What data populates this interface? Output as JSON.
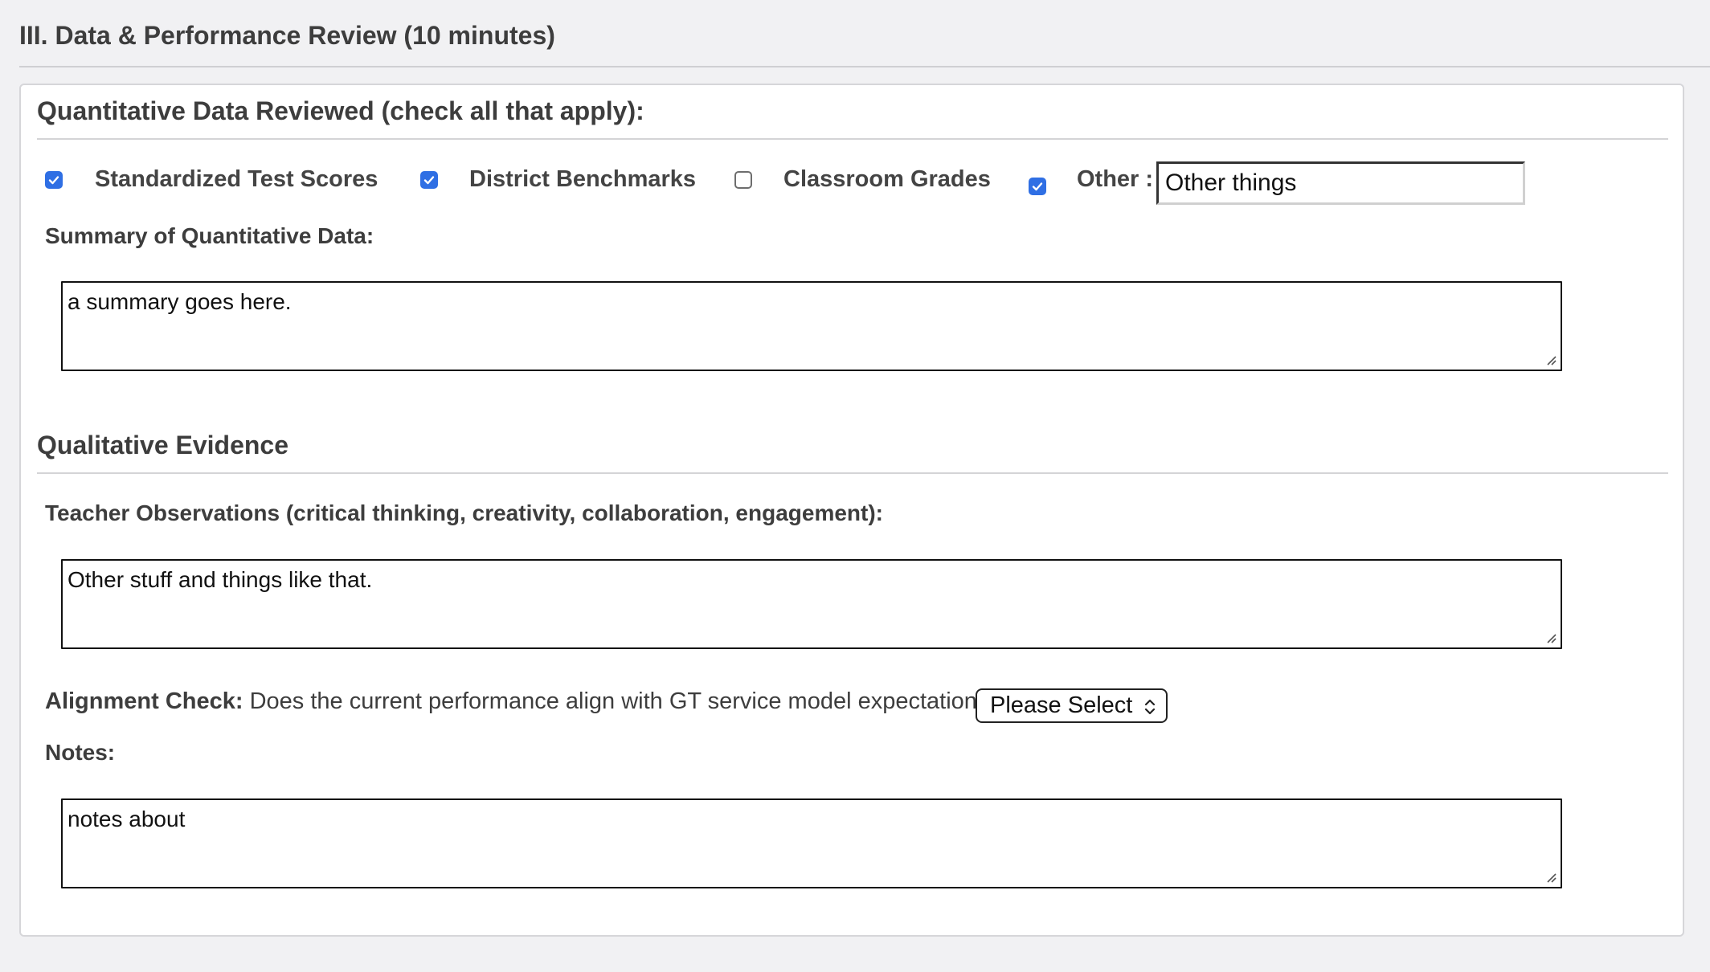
{
  "section": {
    "title": "III. Data & Performance Review (10 minutes)"
  },
  "quantitative": {
    "title": "Quantitative Data Reviewed (check all that apply):",
    "options": [
      {
        "label": "Standardized Test Scores",
        "checked": true
      },
      {
        "label": "District Benchmarks",
        "checked": true
      },
      {
        "label": "Classroom Grades",
        "checked": false
      },
      {
        "label": "Other :",
        "checked": true
      }
    ],
    "other_value": "Other things",
    "summary_label": "Summary of Quantitative Data:",
    "summary_value": "a summary goes here."
  },
  "qualitative": {
    "title": "Qualitative Evidence",
    "observations_label": "Teacher Observations (critical thinking, creativity, collaboration, engagement):",
    "observations_value": "Other stuff and things like that.",
    "alignment_label": "Alignment Check:",
    "alignment_question": " Does the current performance align with GT service model expectations?",
    "alignment_select": "Please Select",
    "notes_label": "Notes:",
    "notes_value": "notes about"
  },
  "colors": {
    "checkbox_accent": "#2f6fe4",
    "page_bg": "#f1f1f3"
  }
}
